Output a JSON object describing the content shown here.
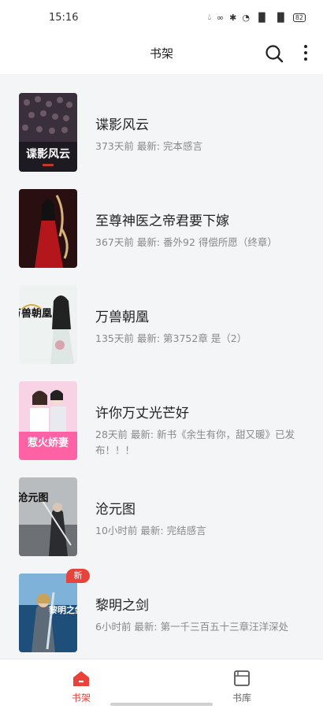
{
  "status_bar": {
    "time": "15:16",
    "battery": "82"
  },
  "header": {
    "title": "书架"
  },
  "books": [
    {
      "title": "谍影风云",
      "meta": "373天前 最新: 完本感言",
      "new": false,
      "cover": "dark-crowd"
    },
    {
      "title": "至尊神医之帝君要下嫁",
      "meta": "367天前 最新: 番外92 得偿所愿（终章）",
      "new": false,
      "cover": "red-robe"
    },
    {
      "title": "万兽朝凰",
      "meta": "135天前 最新: 第3752章 是（2）",
      "new": false,
      "cover": "white-lady"
    },
    {
      "title": "许你万丈光芒好",
      "meta": "28天前 最新: 新书《余生有你，甜又暖》已发布！！！",
      "new": false,
      "cover": "pink-couple"
    },
    {
      "title": "沧元图",
      "meta": "10小时前 最新: 完结感言",
      "new": false,
      "cover": "gray-warrior"
    },
    {
      "title": "黎明之剑",
      "meta": "6小时前 最新: 第一千三百五十三章汪洋深处",
      "new": true,
      "cover": "blue-knight"
    }
  ],
  "new_badge": "新",
  "cover_texts": {
    "c1": "谍影风云",
    "c3": "万兽朝凰",
    "c4": "惹火娇妻",
    "c5": "沧元图",
    "c6": "黎明之剑"
  },
  "bottom_nav": {
    "shelf_label": "书架",
    "library_label": "书库"
  },
  "colors": {
    "accent": "#e8423a",
    "background": "#f4f5f7"
  }
}
